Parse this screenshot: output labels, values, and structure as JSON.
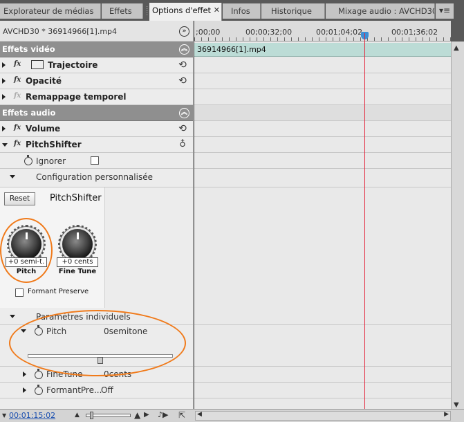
{
  "tabs": [
    {
      "label": "Explorateur de médias"
    },
    {
      "label": "Effets"
    },
    {
      "label": "Options d'effet",
      "close": "✕"
    },
    {
      "label": "Infos"
    },
    {
      "label": "Historique"
    },
    {
      "label": "Mixage audio : AVCHD30"
    }
  ],
  "panel_menu": "▾≡",
  "sequence_title": "AVCHD30 * 36914966[1].mp4",
  "sections": {
    "video": "Effets vidéo",
    "audio": "Effets audio"
  },
  "effects": {
    "trajectoire": "Trajectoire",
    "opacite": "Opacité",
    "remappage": "Remappage temporel",
    "volume": "Volume",
    "pitchshifter": "PitchShifter"
  },
  "fx_label": "fx",
  "ignorer": "Ignorer",
  "config": "Configuration personnalisée",
  "plugin": {
    "reset": "Reset",
    "name": "PitchShifter",
    "pitch_value": "+0 semi-t.",
    "pitch_label": "Pitch",
    "finetune_value": "+0 cents",
    "finetune_label": "Fine Tune",
    "formant_label": "Formant Preserve"
  },
  "params_individuels": "Paramètres individuels",
  "params": [
    {
      "name": "Pitch",
      "value": "0semitone"
    },
    {
      "name": "FineTune",
      "value": "0cents"
    },
    {
      "name": "FormantPre...",
      "value": "Off"
    }
  ],
  "pitch_slider_position": 0.5,
  "timeline": {
    "ticks": [
      ";00;00",
      "00;00;32;00",
      "00;01;04;02",
      "00;01;36;02"
    ],
    "clip_name": "36914966[1].mp4"
  },
  "timecode": "00:01:15:02",
  "colors": {
    "highlight": "#f07a1a",
    "playhead": "#e4253b",
    "clip": "#bcdcd6"
  }
}
